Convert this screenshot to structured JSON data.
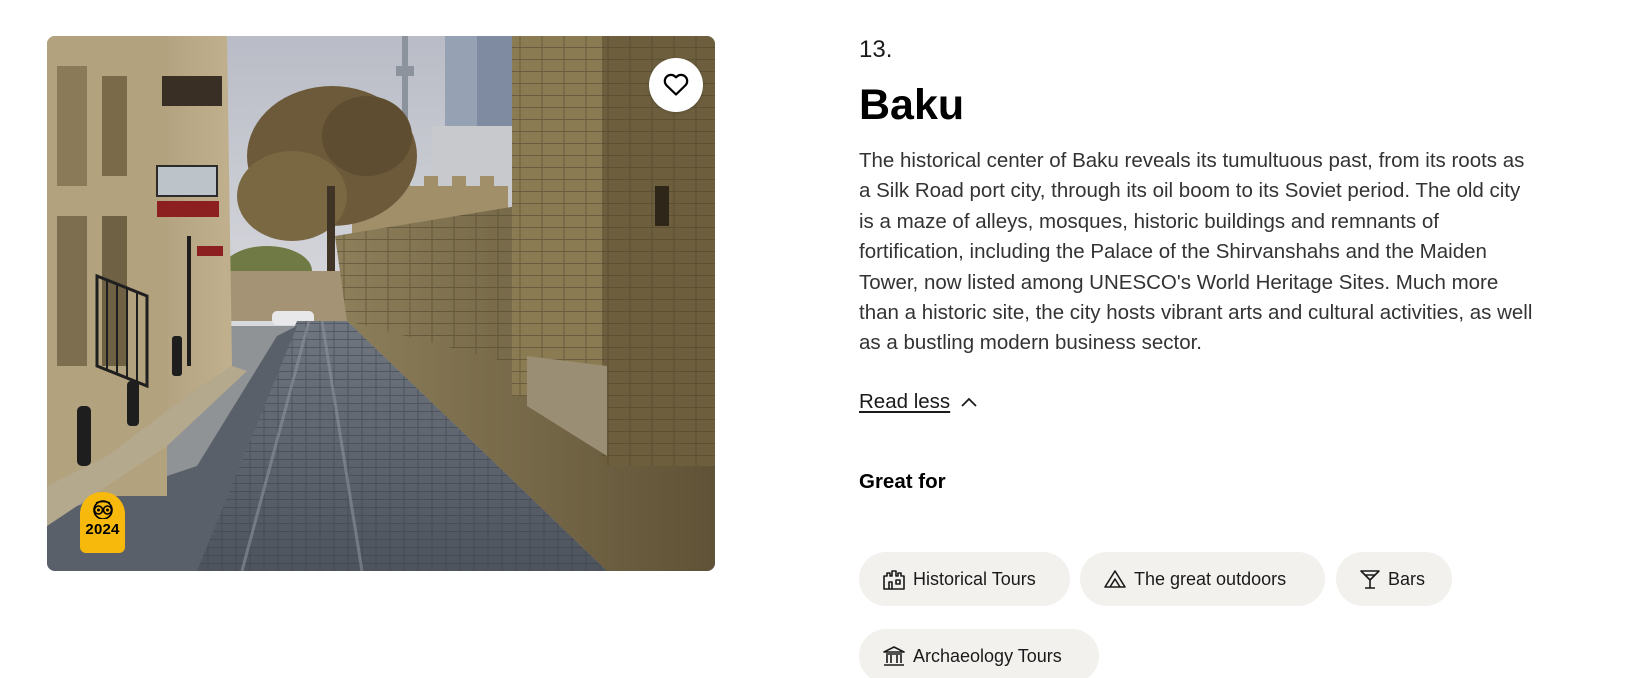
{
  "photo": {
    "award": {
      "year": "2024",
      "icon": "tripadvisor-owl-icon"
    },
    "save_icon": "heart-icon"
  },
  "destination": {
    "rank": "13.",
    "name": "Baku",
    "description": "The historical center of Baku reveals its tumultuous past, from its roots as a Silk Road port city, through its oil boom to its Soviet period. The old city is a maze of alleys, mosques, historic buildings and remnants of fortification, including the Palace of the Shirvanshahs and the Maiden Tower, now listed among UNESCO's World Heritage Sites. Much more than a historic site, the city hosts vibrant arts and cultural activities, as well as a bustling modern business sector.",
    "read_less_label": "Read less"
  },
  "great_for": {
    "heading": "Great for",
    "tags": [
      {
        "label": "Historical Tours",
        "icon": "castle-icon"
      },
      {
        "label": "The great outdoors",
        "icon": "mountain-icon"
      },
      {
        "label": "Bars",
        "icon": "cocktail-icon"
      },
      {
        "label": "Archaeology Tours",
        "icon": "museum-icon"
      }
    ]
  },
  "colors": {
    "award_badge": "#f7b90c",
    "chip_background": "#f2f1ee",
    "text_primary": "#000000",
    "text_body": "#333333"
  }
}
